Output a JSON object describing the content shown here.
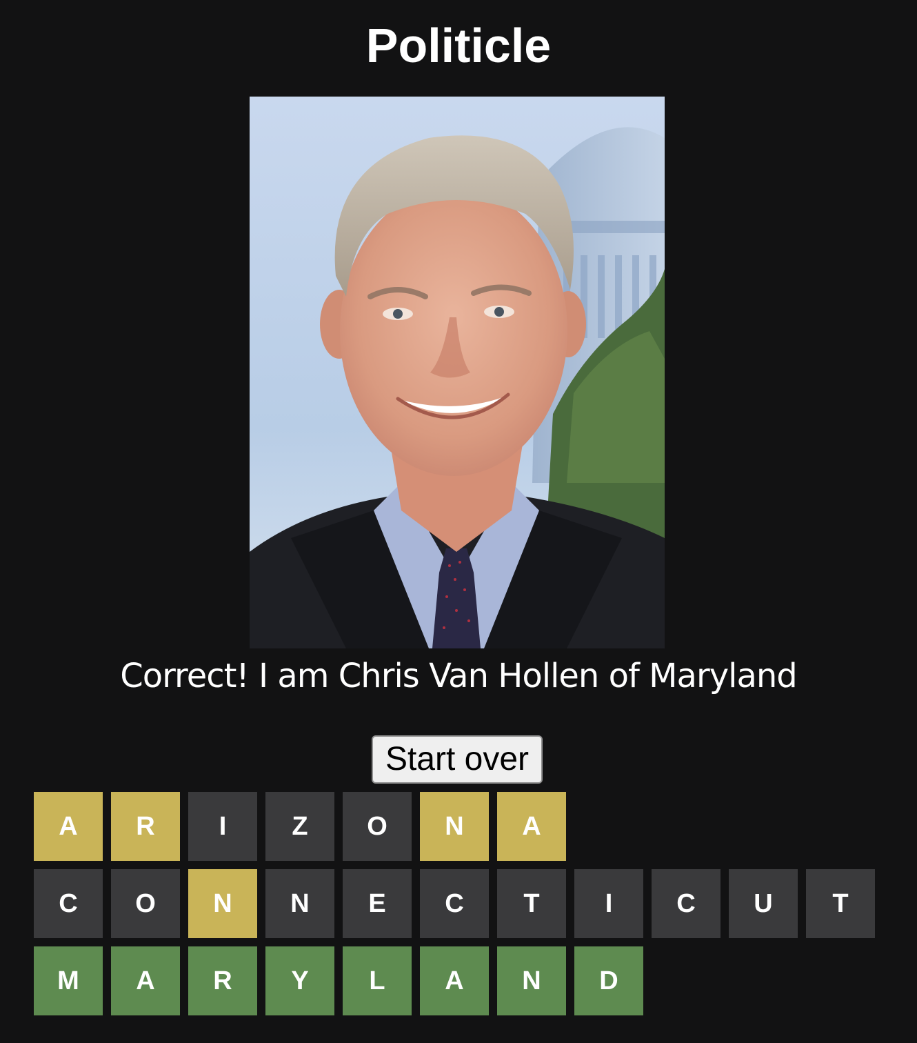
{
  "app": {
    "title": "Politicle"
  },
  "photo": {
    "alt": "Portrait photo of Chris Van Hollen in front of the U.S. Capitol dome"
  },
  "message": "Correct! I am Chris Van Hollen of Maryland",
  "start_over_label": "Start over",
  "colors": {
    "background": "#121213",
    "absent": "#3a3a3c",
    "present": "#c9b458",
    "correct": "#5e8b50"
  },
  "guesses": [
    {
      "word": "ARIZONA",
      "tiles": [
        {
          "letter": "A",
          "state": "present"
        },
        {
          "letter": "R",
          "state": "present"
        },
        {
          "letter": "I",
          "state": "absent"
        },
        {
          "letter": "Z",
          "state": "absent"
        },
        {
          "letter": "O",
          "state": "absent"
        },
        {
          "letter": "N",
          "state": "present"
        },
        {
          "letter": "A",
          "state": "present"
        }
      ]
    },
    {
      "word": "CONNECTICUT",
      "tiles": [
        {
          "letter": "C",
          "state": "absent"
        },
        {
          "letter": "O",
          "state": "absent"
        },
        {
          "letter": "N",
          "state": "present"
        },
        {
          "letter": "N",
          "state": "absent"
        },
        {
          "letter": "E",
          "state": "absent"
        },
        {
          "letter": "C",
          "state": "absent"
        },
        {
          "letter": "T",
          "state": "absent"
        },
        {
          "letter": "I",
          "state": "absent"
        },
        {
          "letter": "C",
          "state": "absent"
        },
        {
          "letter": "U",
          "state": "absent"
        },
        {
          "letter": "T",
          "state": "absent"
        }
      ]
    },
    {
      "word": "MARYLAND",
      "tiles": [
        {
          "letter": "M",
          "state": "correct"
        },
        {
          "letter": "A",
          "state": "correct"
        },
        {
          "letter": "R",
          "state": "correct"
        },
        {
          "letter": "Y",
          "state": "correct"
        },
        {
          "letter": "L",
          "state": "correct"
        },
        {
          "letter": "A",
          "state": "correct"
        },
        {
          "letter": "N",
          "state": "correct"
        },
        {
          "letter": "D",
          "state": "correct"
        }
      ]
    }
  ]
}
